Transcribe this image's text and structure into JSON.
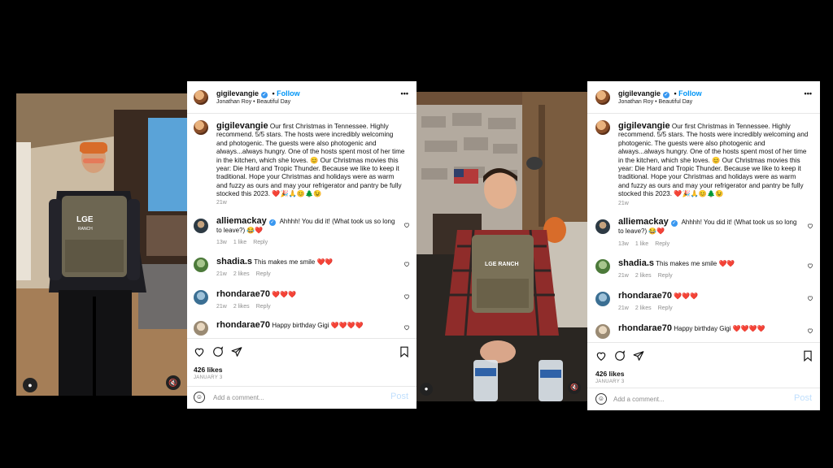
{
  "posts": [
    {
      "author": "gigilevangie",
      "follow_label": "Follow",
      "subtitle": "Jonathan Roy • Beautiful Day",
      "more_label": "•••",
      "caption_user": "gigilevangie",
      "caption": "Our first Christmas in Tennessee. Highly recommend. 5/5 stars. The hosts were incredibly welcoming and photogenic. The guests were also photogenic and always...always hungry. One of the hosts spent most of her time in the kitchen, which she loves. 😊 Our Christmas movies this year: Die Hard and Tropic Thunder. Because we like to keep it traditional. Hope your Christmas and holidays were as warm and fuzzy as ours and may your refrigerator and pantry be fully stocked this 2023. ❤️🎉🙏😊🌲😉",
      "caption_time": "21w",
      "comments": [
        {
          "user": "alliemackay",
          "verified": true,
          "text": "Ahhhh! You did it! (What took us so long to leave?) 😂❤️",
          "time": "13w",
          "likes": "1 like",
          "reply": "Reply"
        },
        {
          "user": "shadia.s",
          "verified": false,
          "text": "This makes me smile ❤️❤️",
          "time": "21w",
          "likes": "2 likes",
          "reply": "Reply"
        },
        {
          "user": "rhondarae70",
          "verified": false,
          "text": "❤️❤️❤️",
          "time": "21w",
          "likes": "2 likes",
          "reply": "Reply"
        },
        {
          "user": "rhondarae70",
          "verified": false,
          "text": "Happy birthday Gigi ❤️❤️❤️❤️",
          "time": "21w",
          "likes": "2 likes",
          "reply": "Reply"
        }
      ],
      "likes": "426 likes",
      "date": "JANUARY 3",
      "add_comment_placeholder": "Add a comment...",
      "post_label": "Post"
    },
    {
      "author": "gigilevangie",
      "follow_label": "Follow",
      "subtitle": "Jonathan Roy • Beautiful Day",
      "more_label": "•••",
      "caption_user": "gigilevangie",
      "caption": "Our first Christmas in Tennessee. Highly recommend. 5/5 stars. The hosts were incredibly welcoming and photogenic. The guests were also photogenic and always...always hungry. One of the hosts spent most of her time in the kitchen, which she loves. 😊 Our Christmas movies this year: Die Hard and Tropic Thunder. Because we like to keep it traditional. Hope your Christmas and holidays were as warm and fuzzy as ours and may your refrigerator and pantry be fully stocked this 2023. ❤️🎉🙏😊🌲😉",
      "caption_time": "21w",
      "comments": [
        {
          "user": "alliemackay",
          "verified": true,
          "text": "Ahhhh! You did it! (What took us so long to leave?) 😂❤️",
          "time": "13w",
          "likes": "1 like",
          "reply": "Reply"
        },
        {
          "user": "shadia.s",
          "verified": false,
          "text": "This makes me smile ❤️❤️",
          "time": "21w",
          "likes": "2 likes",
          "reply": "Reply"
        },
        {
          "user": "rhondarae70",
          "verified": false,
          "text": "❤️❤️❤️",
          "time": "21w",
          "likes": "2 likes",
          "reply": "Reply"
        },
        {
          "user": "rhondarae70",
          "verified": false,
          "text": "Happy birthday Gigi ❤️❤️❤️❤️",
          "time": "21w",
          "likes": "2 likes",
          "reply": "Reply"
        }
      ],
      "likes": "426 likes",
      "date": "JANUARY 3",
      "add_comment_placeholder": "Add a comment...",
      "post_label": "Post"
    }
  ],
  "photos": [
    {
      "vest_text": "LGE\nRANCH"
    },
    {
      "vest_text": "LGE RANCH"
    }
  ],
  "colors": {
    "accent": "#0095f6",
    "heart": "#e0245e",
    "post_disabled": "#c0dffd"
  }
}
